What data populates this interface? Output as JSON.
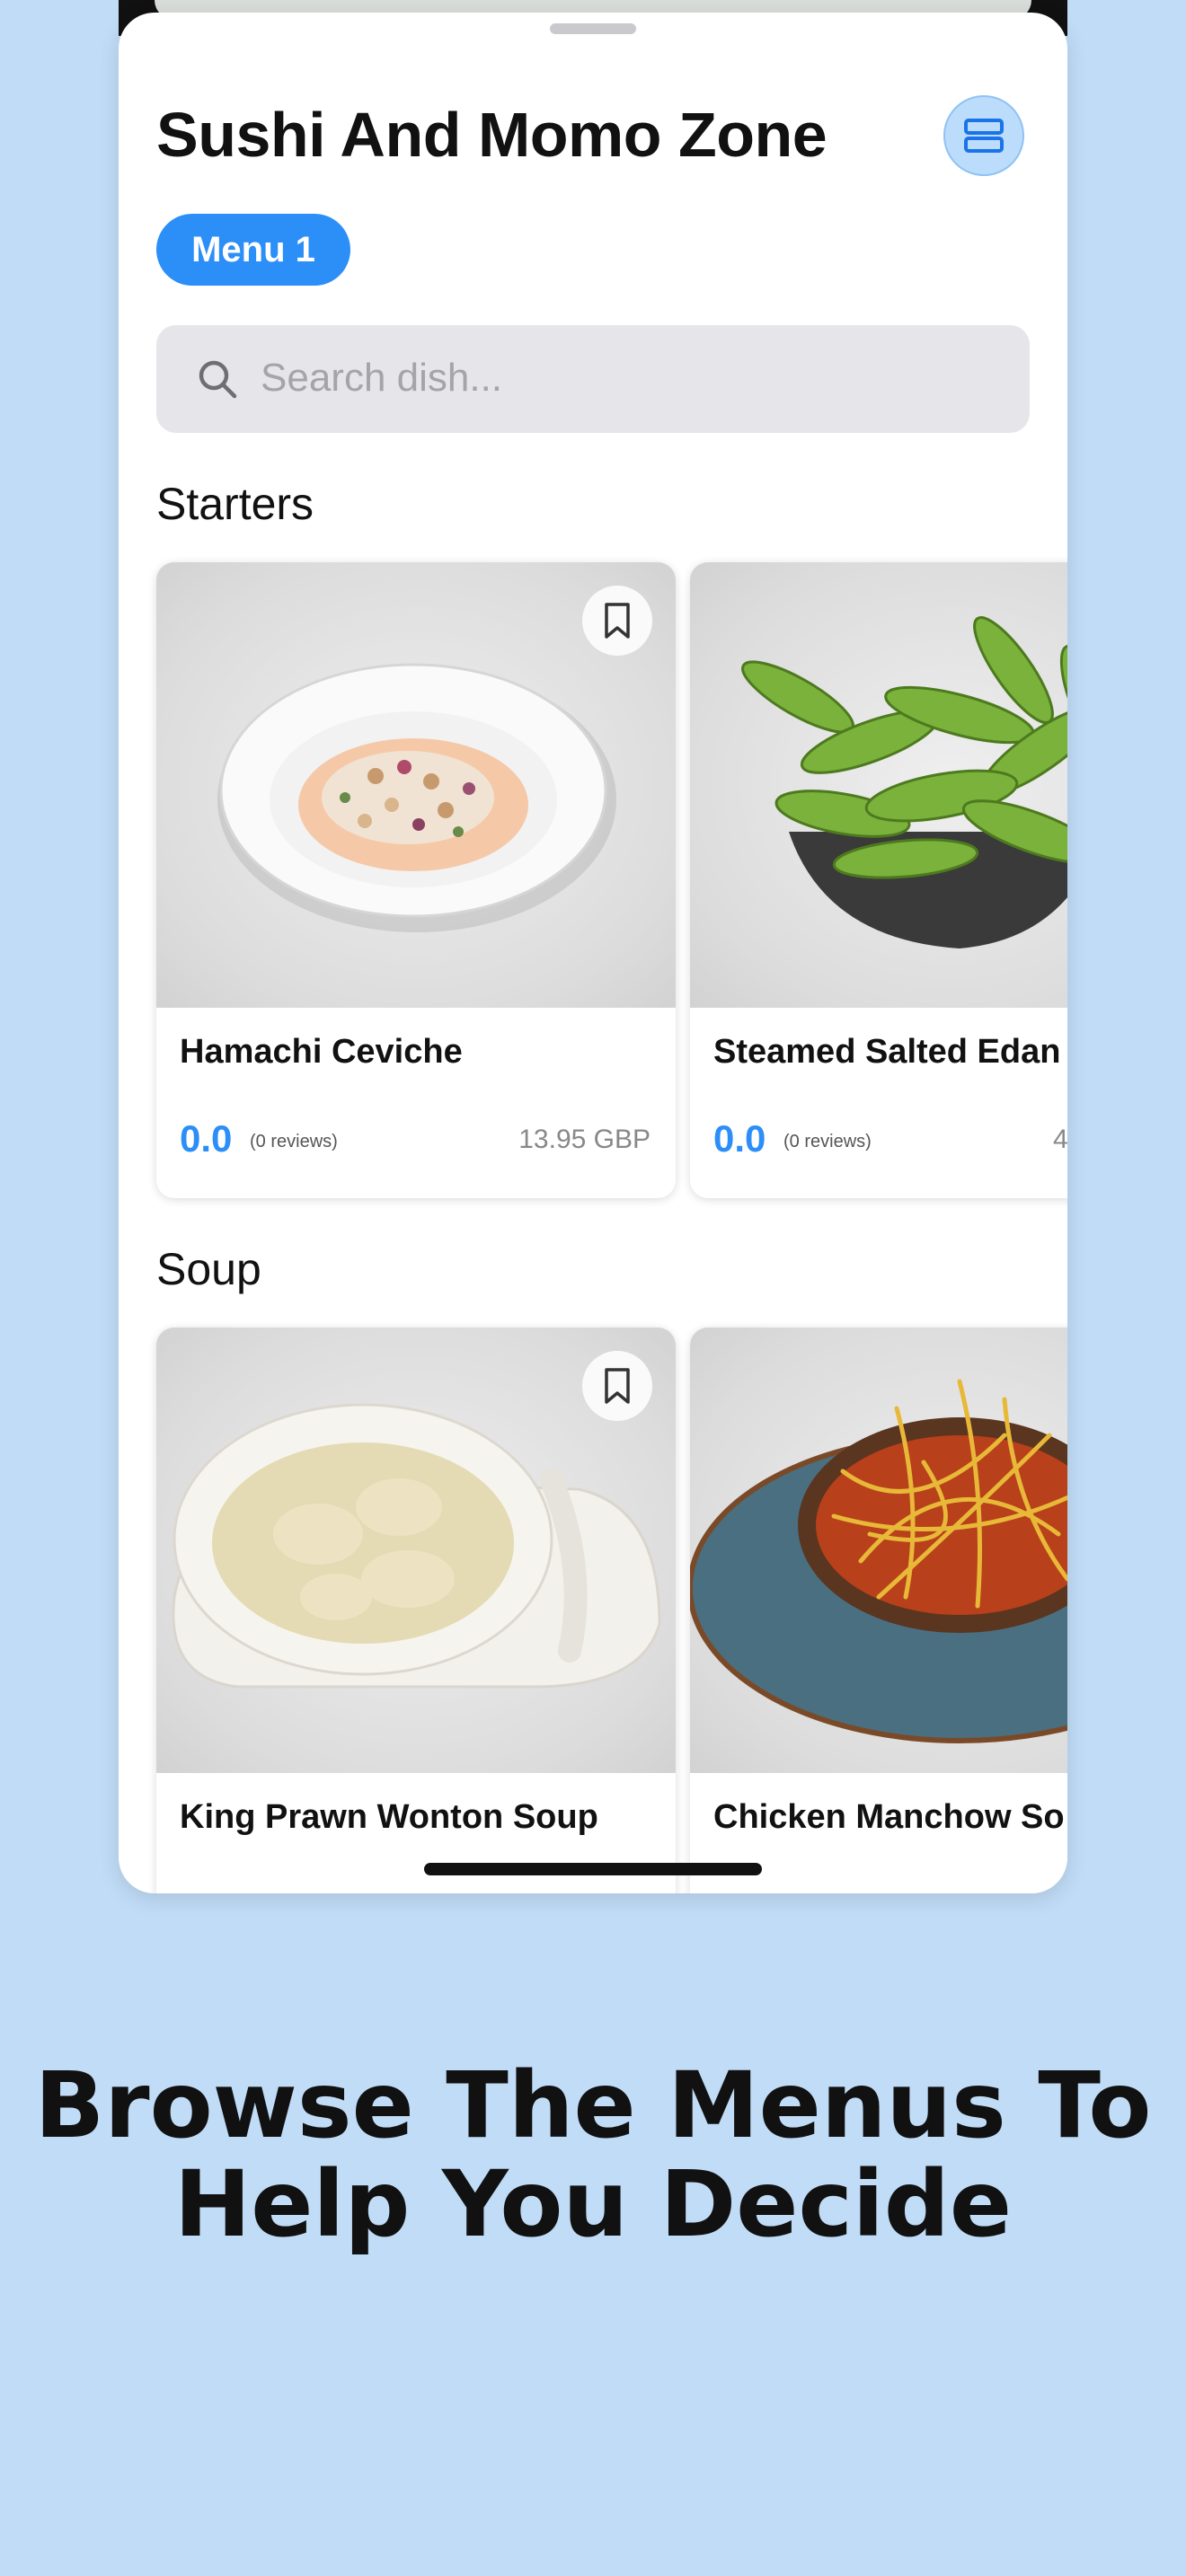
{
  "restaurant": {
    "name": "Sushi And Momo Zone"
  },
  "menu_tabs": [
    {
      "label": "Menu 1",
      "selected": true
    }
  ],
  "search": {
    "placeholder": "Search dish..."
  },
  "sections": [
    {
      "title": "Starters",
      "items": [
        {
          "name": "Hamachi Ceviche",
          "rating": "0.0",
          "reviews": "(0 reviews)",
          "price": "13.95 GBP"
        },
        {
          "name": "Steamed Salted Edan",
          "rating": "0.0",
          "reviews": "(0 reviews)",
          "price": "4"
        }
      ]
    },
    {
      "title": "Soup",
      "items": [
        {
          "name": "King Prawn Wonton Soup"
        },
        {
          "name": "Chicken Manchow So"
        }
      ]
    }
  ],
  "caption": {
    "line1": "Browse The Menus To",
    "line2": "Help You Decide"
  },
  "colors": {
    "background": "#c1dcf7",
    "accent": "#2c8ef7"
  },
  "icons": [
    "layout-toggle-icon",
    "search-icon",
    "bookmark-icon"
  ]
}
